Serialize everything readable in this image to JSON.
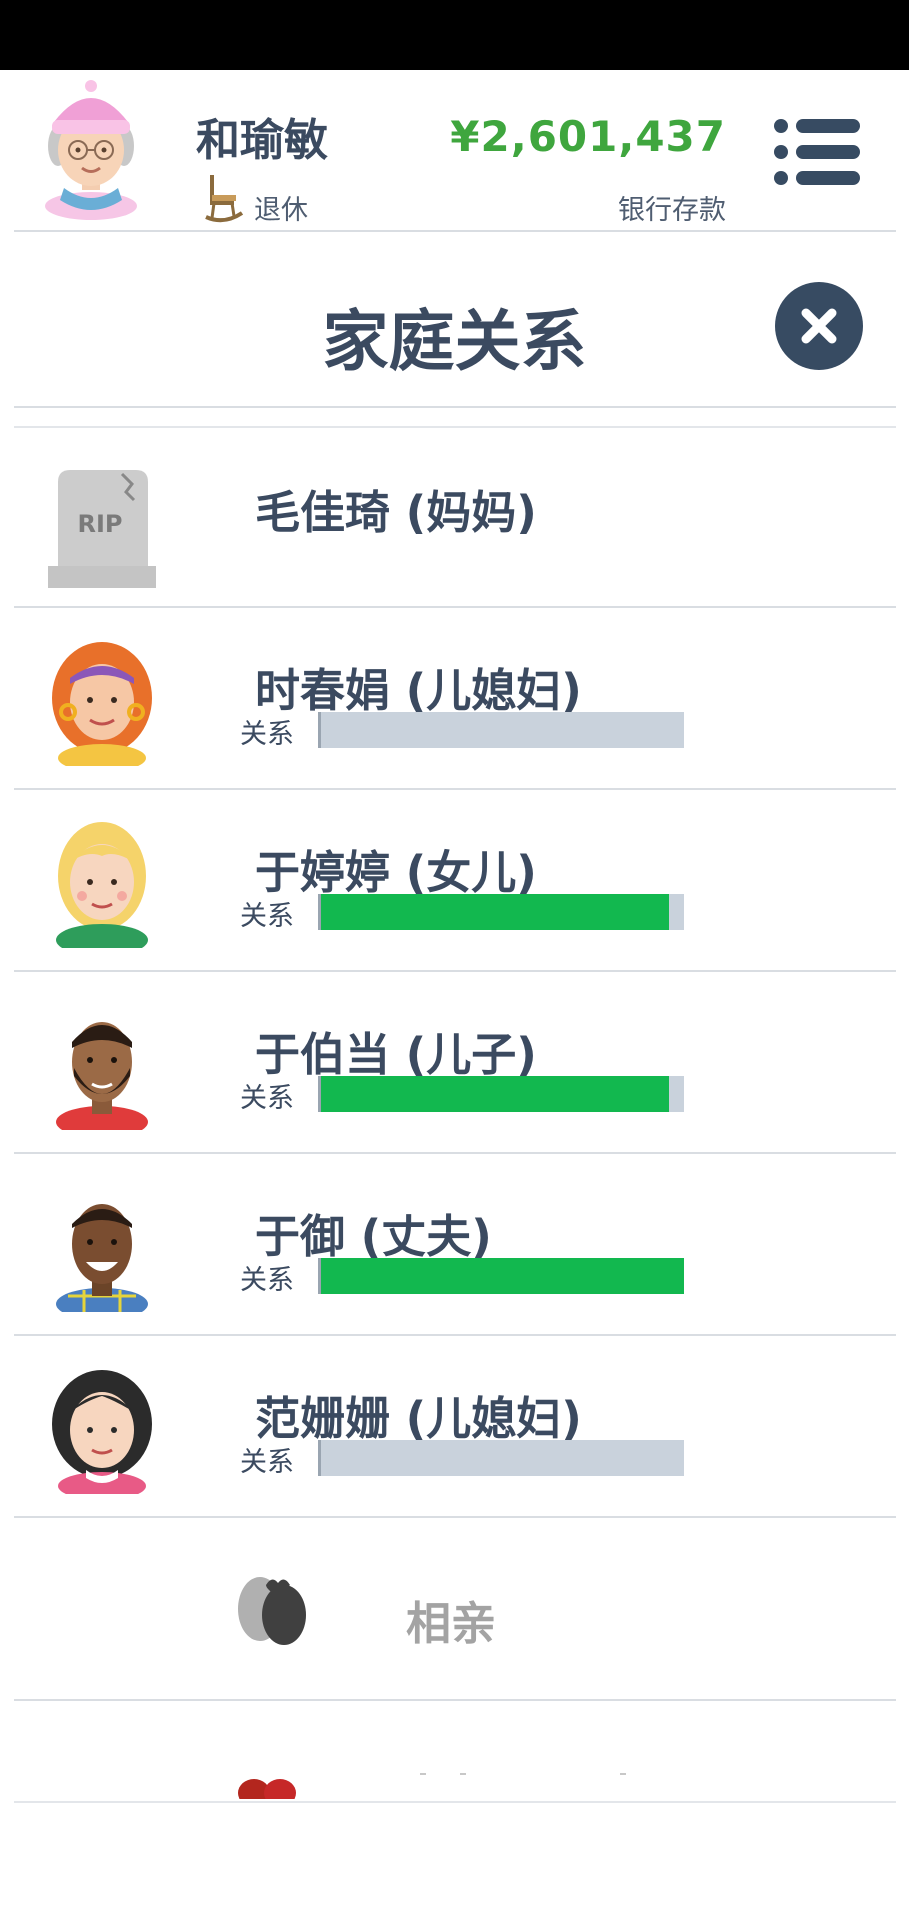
{
  "header": {
    "player_name": "和瑜敏",
    "status": "退休",
    "money": "¥2,601,437",
    "bank_label": "银行存款"
  },
  "dialog": {
    "title": "家庭关系"
  },
  "relationships": [
    {
      "name": "毛佳琦 (妈妈)",
      "avatar": "tombstone-rip-icon",
      "rip_text": "RIP",
      "deceased": true
    },
    {
      "name": "时春娟 (儿媳妇)",
      "avatar": "red-haired-woman-avatar",
      "relation_label": "关系",
      "relation_level": 0.0
    },
    {
      "name": "于婷婷 (女儿)",
      "avatar": "blonde-woman-avatar",
      "relation_label": "关系",
      "relation_level": 0.96
    },
    {
      "name": "于伯当 (儿子)",
      "avatar": "bearded-man-avatar",
      "relation_label": "关系",
      "relation_level": 0.96
    },
    {
      "name": "于御 (丈夫)",
      "avatar": "smiling-man-avatar",
      "relation_label": "关系",
      "relation_level": 1.0
    },
    {
      "name": "范姗姗 (儿媳妇)",
      "avatar": "dark-haired-woman-avatar",
      "relation_label": "关系",
      "relation_level": 0.0
    }
  ],
  "blind_date": {
    "label": "相亲",
    "icon": "couple-silhouette-icon"
  },
  "colors": {
    "accent_dark": "#374b62",
    "money_green": "#3fa63e",
    "bar_fill": "#12b84f",
    "bar_track": "#c9d2dc"
  }
}
